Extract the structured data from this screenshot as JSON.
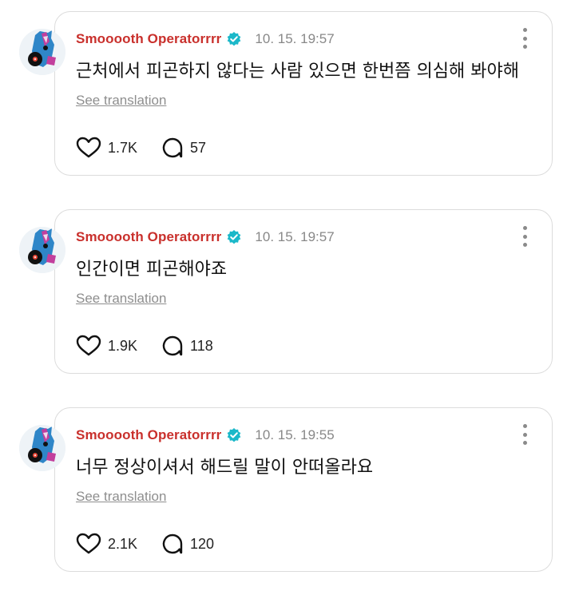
{
  "posts": [
    {
      "author": "Smooooth Operatorrrr",
      "time": "10. 15. 19:57",
      "text": "근처에서 피곤하지 않다는 사람 있으면 한번쯤 의심해 봐야해",
      "translate_label": "See translation",
      "likes": "1.7K",
      "comments": "57"
    },
    {
      "author": "Smooooth Operatorrrr",
      "time": "10. 15. 19:57",
      "text": "인간이면 피곤해야죠",
      "translate_label": "See translation",
      "likes": "1.9K",
      "comments": "118"
    },
    {
      "author": "Smooooth Operatorrrr",
      "time": "10. 15. 19:55",
      "text": "너무 정상이셔서 해드릴 말이 안떠올라요",
      "translate_label": "See translation",
      "likes": "2.1K",
      "comments": "120"
    }
  ],
  "icons": {
    "verified": "verified-badge-icon",
    "like": "heart-icon",
    "comment": "speech-bubble-icon",
    "more": "more-vertical-icon"
  },
  "colors": {
    "author": "#c9302c",
    "verified": "#1bb8c9",
    "muted": "#888888",
    "border": "#dcdcdc"
  }
}
